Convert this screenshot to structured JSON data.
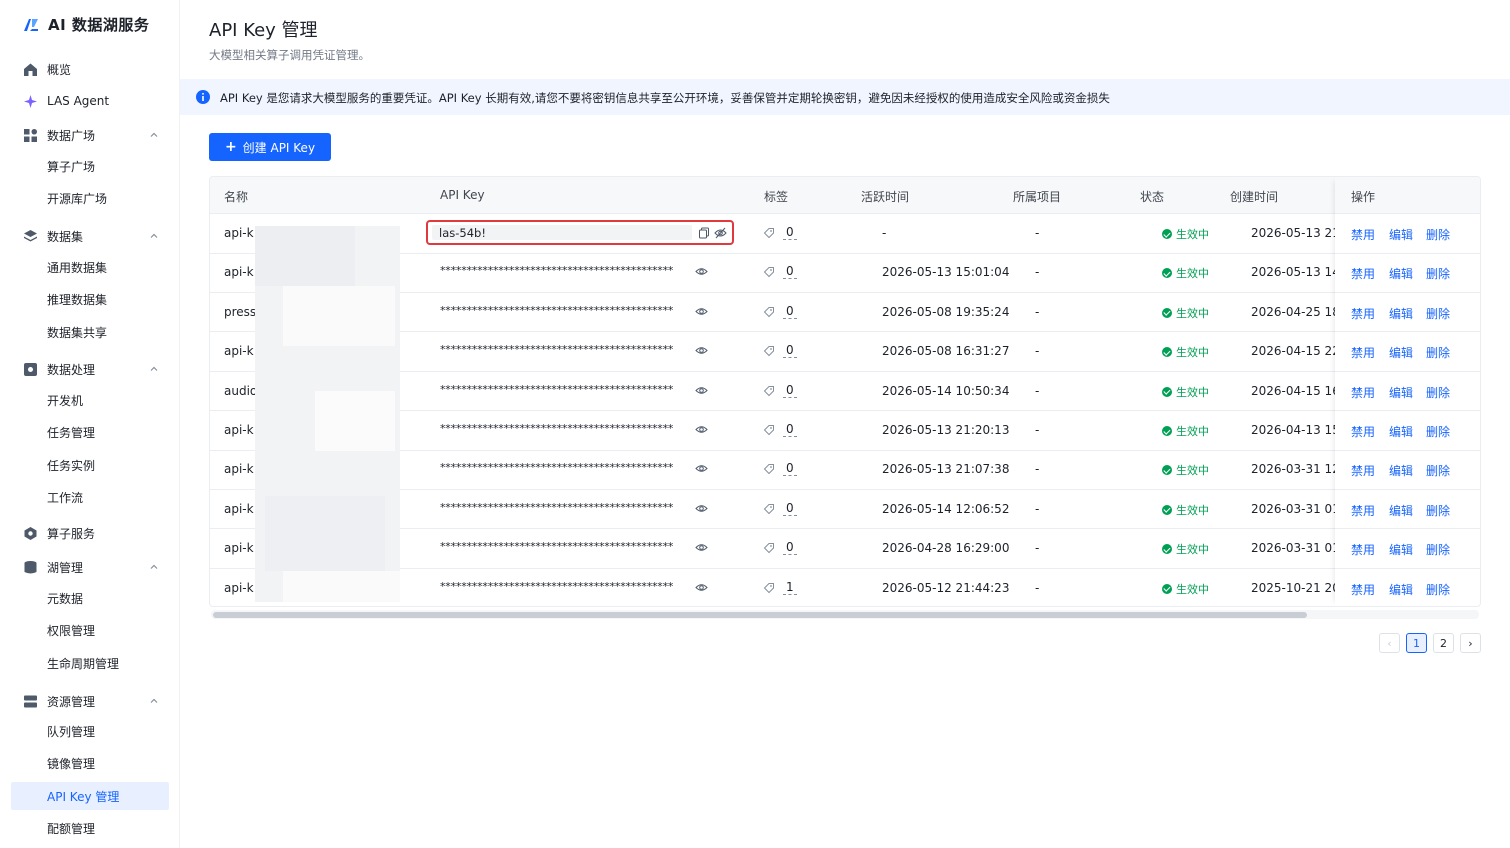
{
  "app": {
    "title": "AI 数据湖服务"
  },
  "sidebar": {
    "items": [
      {
        "label": "概览",
        "icon": "home-icon"
      },
      {
        "label": "LAS Agent",
        "icon": "sparkle-icon"
      },
      {
        "label": "数据广场",
        "icon": "grid-icon"
      },
      {
        "label": "算子广场"
      },
      {
        "label": "开源库广场"
      },
      {
        "label": "数据集",
        "icon": "layers-icon"
      },
      {
        "label": "通用数据集"
      },
      {
        "label": "推理数据集"
      },
      {
        "label": "数据集共享"
      },
      {
        "label": "数据处理",
        "icon": "gear-box-icon"
      },
      {
        "label": "开发机"
      },
      {
        "label": "任务管理"
      },
      {
        "label": "任务实例"
      },
      {
        "label": "工作流"
      },
      {
        "label": "算子服务",
        "icon": "hexagon-icon"
      },
      {
        "label": "湖管理",
        "icon": "database-icon"
      },
      {
        "label": "元数据"
      },
      {
        "label": "权限管理"
      },
      {
        "label": "生命周期管理"
      },
      {
        "label": "资源管理",
        "icon": "server-icon"
      },
      {
        "label": "队列管理"
      },
      {
        "label": "镜像管理"
      },
      {
        "label": "API Key 管理"
      },
      {
        "label": "配额管理"
      }
    ]
  },
  "header": {
    "title": "API Key 管理",
    "subtitle": "大模型相关算子调用凭证管理。"
  },
  "banner": {
    "text": "API Key 是您请求大模型服务的重要凭证。API Key 长期有效,请您不要将密钥信息共享至公开环境，妥善保管并定期轮换密钥，避免因未经授权的使用造成安全风险或资金损失"
  },
  "toolbar": {
    "create_label": "创建 API Key"
  },
  "table": {
    "headers": {
      "name": "名称",
      "key": "API Key",
      "tag": "标签",
      "active": "活跃时间",
      "project": "所属项目",
      "status": "状态",
      "created": "创建时间",
      "ops": "操作"
    },
    "first_key_value": "las-54b!",
    "mask": "********************************************",
    "rows": [
      {
        "name": "api-k",
        "tags": "0",
        "active": "-",
        "project": "-",
        "status": "生效中",
        "created": "2026-05-13 21:",
        "disable": "禁用",
        "edit": "编辑",
        "delete": "删除"
      },
      {
        "name": "api-k",
        "tags": "0",
        "active": "2026-05-13 15:01:04",
        "project": "-",
        "status": "生效中",
        "created": "2026-05-13 14:",
        "disable": "禁用",
        "edit": "编辑",
        "delete": "删除"
      },
      {
        "name": "press",
        "tags": "0",
        "active": "2026-05-08 19:35:24",
        "project": "-",
        "status": "生效中",
        "created": "2026-04-25 18",
        "disable": "禁用",
        "edit": "编辑",
        "delete": "删除"
      },
      {
        "name": "api-k",
        "tags": "0",
        "active": "2026-05-08 16:31:27",
        "project": "-",
        "status": "生效中",
        "created": "2026-04-15 22",
        "disable": "禁用",
        "edit": "编辑",
        "delete": "删除"
      },
      {
        "name": "audio",
        "tags": "0",
        "active": "2026-05-14 10:50:34",
        "project": "-",
        "status": "生效中",
        "created": "2026-04-15 16:",
        "disable": "禁用",
        "edit": "编辑",
        "delete": "删除"
      },
      {
        "name": "api-k",
        "tags": "0",
        "active": "2026-05-13 21:20:13",
        "project": "-",
        "status": "生效中",
        "created": "2026-04-13 15:",
        "disable": "禁用",
        "edit": "编辑",
        "delete": "删除"
      },
      {
        "name": "api-k",
        "tags": "0",
        "active": "2026-05-13 21:07:38",
        "project": "-",
        "status": "生效中",
        "created": "2026-03-31 12:",
        "disable": "禁用",
        "edit": "编辑",
        "delete": "删除"
      },
      {
        "name": "api-k",
        "tags": "0",
        "active": "2026-05-14 12:06:52",
        "project": "-",
        "status": "生效中",
        "created": "2026-03-31 01:",
        "disable": "禁用",
        "edit": "编辑",
        "delete": "删除"
      },
      {
        "name": "api-k",
        "tags": "0",
        "active": "2026-04-28 16:29:00",
        "project": "-",
        "status": "生效中",
        "created": "2026-03-31 01:",
        "disable": "禁用",
        "edit": "编辑",
        "delete": "删除"
      },
      {
        "name": "api-k",
        "tags": "1",
        "active": "2026-05-12 21:44:23",
        "project": "-",
        "status": "生效中",
        "created": "2025-10-21 20:",
        "disable": "禁用",
        "edit": "编辑",
        "delete": "删除"
      }
    ]
  },
  "pagination": {
    "prev": "‹",
    "pages": [
      "1",
      "2"
    ],
    "current": "1",
    "next": "›"
  },
  "colors": {
    "accent": "#1664ff",
    "success": "#00a054",
    "highlight": "#e0393e"
  }
}
